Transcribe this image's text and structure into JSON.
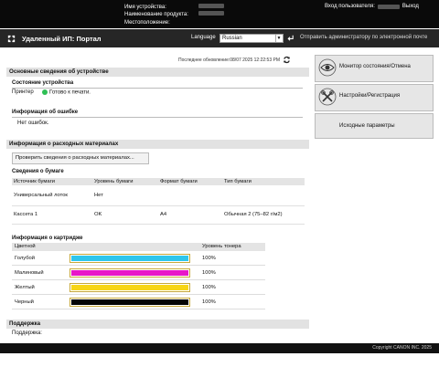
{
  "header": {
    "device_name_label": "Имя устройства:",
    "product_name_label": "Наименование продукта:",
    "location_label": "Местоположение:",
    "login_label": "Вход пользователя:",
    "logout_label": "Выход"
  },
  "portal": {
    "title": "Удаленный ИП: Портал",
    "language_label": "Language",
    "language_value": "Russian",
    "admin_link": "Отправить администратору по электронной почте"
  },
  "main": {
    "last_updated": "Последнее обновление:08/07 2025 12:22:53 PM",
    "device_basic_title": "Основные сведения об устройстве",
    "device_status_title": "Состояние устройства",
    "printer_label": "Принтер",
    "printer_status": "Готово к печати.",
    "error_info_title": "Информация об ошибке",
    "error_text": "Нет ошибок.",
    "consumables_title": "Информация о расходных материалах",
    "check_button": "Проверить сведения о расходных материалах...",
    "paper_title": "Сведения о бумаге",
    "paper_table": {
      "headers": [
        "Источник бумаги",
        "Уровень бумаги",
        "Формат бумаги",
        "Тип бумаги"
      ],
      "rows": [
        [
          "Универсальный лоток",
          "Нет",
          "",
          ""
        ],
        [
          "Кассета 1",
          "OK",
          "A4",
          "Обычная 2 (75–82 г/м2)"
        ]
      ]
    },
    "cartridge_title": "Информация о картридже",
    "cartridge_headers": {
      "color": "Цветной",
      "level": "Уровень тонера"
    },
    "cartridges": [
      {
        "name": "Голубой",
        "level": "100%",
        "color": "#2ec6ec"
      },
      {
        "name": "Малиновый",
        "level": "100%",
        "color": "#e817c8"
      },
      {
        "name": "Желтый",
        "level": "100%",
        "color": "#f7d516"
      },
      {
        "name": "Черный",
        "level": "100%",
        "color": "#050505"
      }
    ],
    "support_title": "Поддержка",
    "support_label": "Поддержка:"
  },
  "right_panel": {
    "monitor_button": "Монитор состояния/Отмена",
    "settings_button": "Настройки/Регистрация",
    "initial_button": "Исходные параметры"
  },
  "footer": {
    "copyright": "Copyright CANON INC. 2025"
  }
}
